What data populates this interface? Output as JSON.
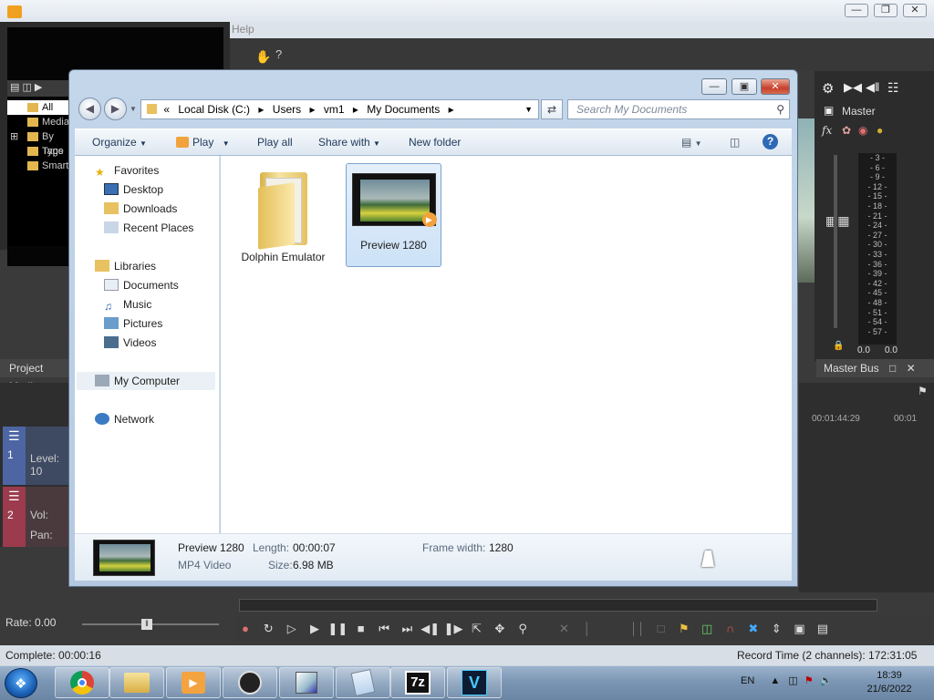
{
  "app": {
    "menu_help": "Help",
    "project_media_tab": "Project Media",
    "explorer_tree": [
      "All Media",
      "Media",
      "By Type",
      "Tags",
      "Smart"
    ],
    "master_label": "Master",
    "master_bus_label": "Master Bus",
    "meter_ticks": [
      "3",
      "6",
      "9",
      "12",
      "15",
      "18",
      "21",
      "24",
      "27",
      "30",
      "33",
      "36",
      "39",
      "42",
      "45",
      "48",
      "51",
      "54",
      "57"
    ],
    "meter_values": [
      "0.0",
      "0.0"
    ],
    "timecode_1": "00:01:44:29",
    "timecode_2": "00:01",
    "track1_num": "1",
    "track1_label": "Level: 10",
    "track2_num": "2",
    "track2_vol": "Vol:",
    "track2_pan": "Pan:",
    "rate": "Rate: 0.00",
    "complete": "Complete: 00:00:16",
    "record_time": "Record Time (2 channels): 172:31:05"
  },
  "explorer": {
    "address": [
      "«",
      "Local Disk (C:)",
      "Users",
      "vm1",
      "My Documents"
    ],
    "search_placeholder": "Search My Documents",
    "commands": {
      "organize": "Organize",
      "play": "Play",
      "play_all": "Play all",
      "share_with": "Share with",
      "new_folder": "New folder"
    },
    "nav": {
      "favorites": "Favorites",
      "desktop": "Desktop",
      "downloads": "Downloads",
      "recent_places": "Recent Places",
      "libraries": "Libraries",
      "documents": "Documents",
      "music": "Music",
      "pictures": "Pictures",
      "videos": "Videos",
      "my_computer": "My Computer",
      "network": "Network"
    },
    "files": [
      {
        "name": "Dolphin Emulator",
        "type": "folder"
      },
      {
        "name": "Preview 1280",
        "type": "video"
      }
    ],
    "details": {
      "name": "Preview 1280",
      "type": "MP4 Video",
      "length_label": "Length:",
      "length": "00:00:07",
      "size_label": "Size:",
      "size": "6.98 MB",
      "frame_width_label": "Frame width:",
      "frame_width": "1280"
    }
  },
  "taskbar": {
    "language": "EN",
    "time": "18:39",
    "date": "21/6/2022",
    "seven_zip": "7z",
    "vegas": "V"
  }
}
